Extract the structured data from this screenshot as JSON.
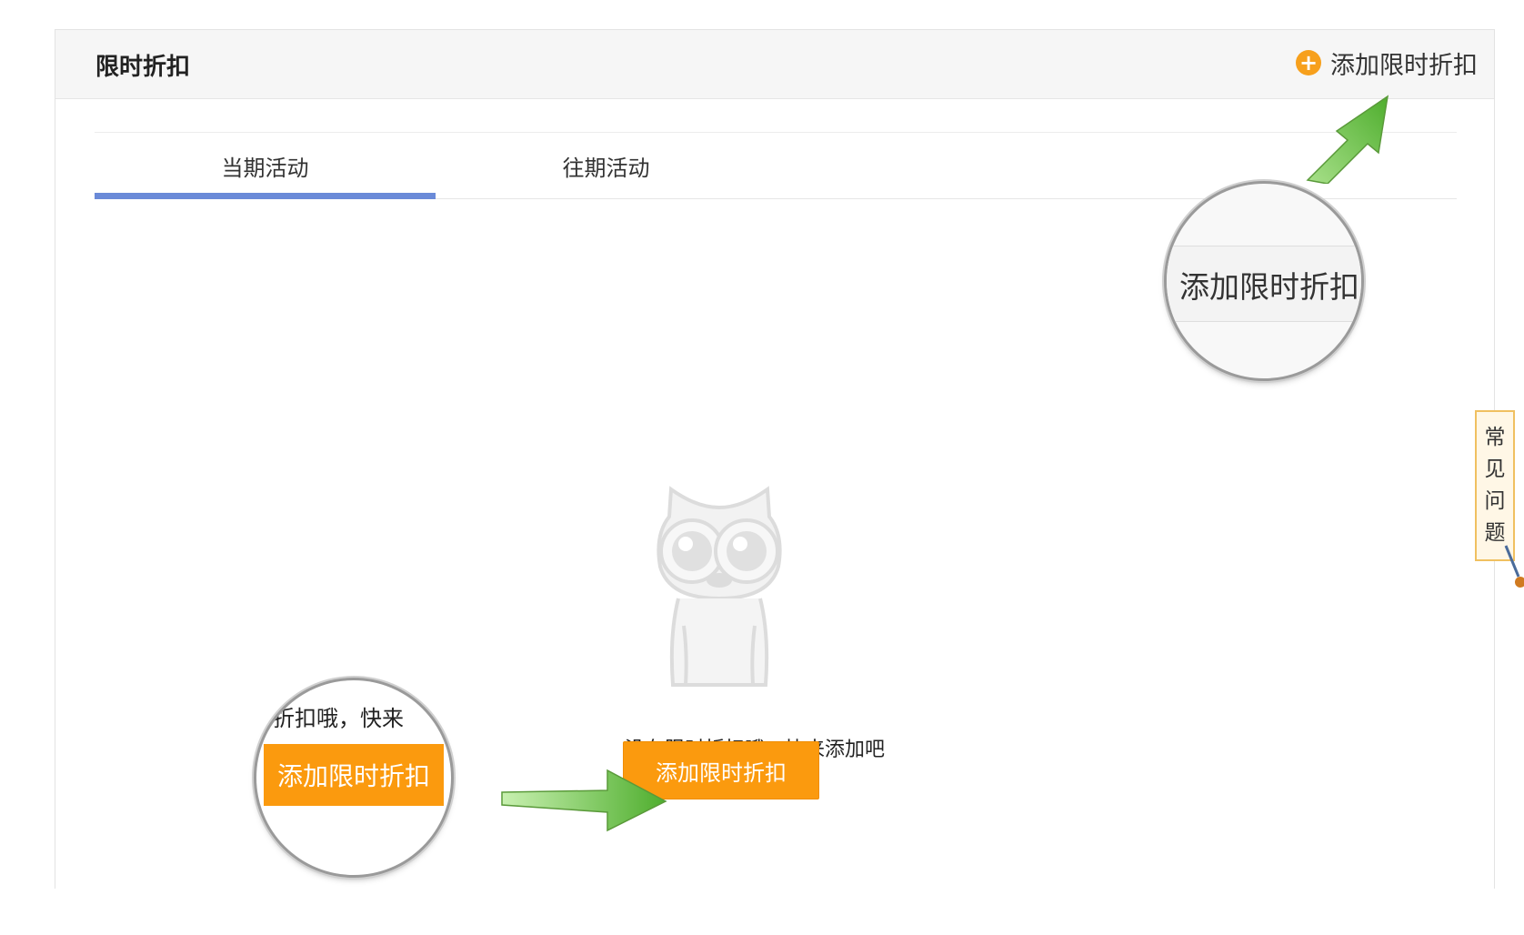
{
  "page": {
    "title": "限时折扣",
    "add_button_label": "添加限时折扣",
    "add_icon": "plus-circle-icon"
  },
  "tabs": [
    {
      "label": "当期活动",
      "active": true
    },
    {
      "label": "往期活动",
      "active": false
    }
  ],
  "empty_state": {
    "illustration": "owl-icon",
    "message": "没有限时折扣哦，快来添加吧",
    "button_label": "添加限时折扣"
  },
  "callouts": {
    "top_zoom_text": "添加限时折扣",
    "bottom_zoom_text": "折扣哦，快来",
    "bottom_zoom_button": "添加限时折扣"
  },
  "faq": {
    "chars": [
      "常",
      "见",
      "问",
      "题"
    ]
  },
  "colors": {
    "accent_orange": "#fb9a0e",
    "tab_underline": "#6a8ad8",
    "arrow_green": "#6cc94a"
  }
}
